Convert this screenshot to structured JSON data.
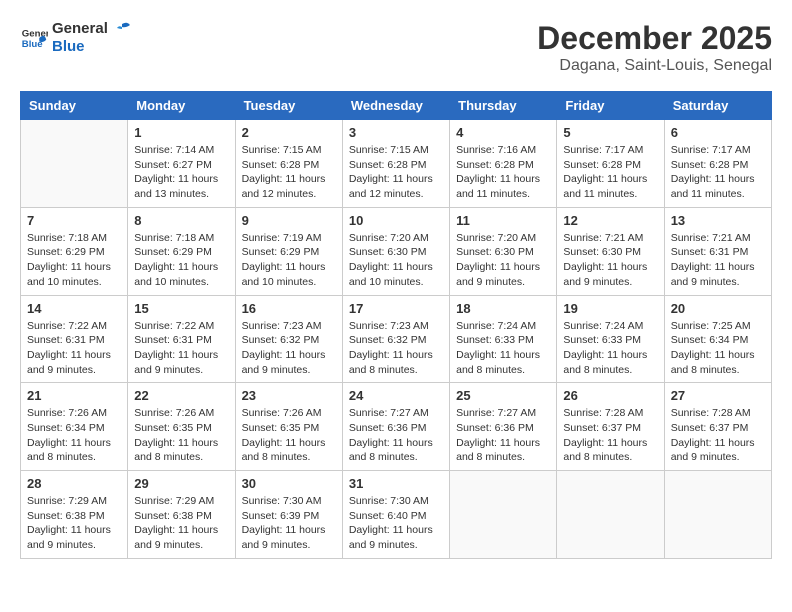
{
  "header": {
    "logo_general": "General",
    "logo_blue": "Blue",
    "month": "December 2025",
    "location": "Dagana, Saint-Louis, Senegal"
  },
  "days_of_week": [
    "Sunday",
    "Monday",
    "Tuesday",
    "Wednesday",
    "Thursday",
    "Friday",
    "Saturday"
  ],
  "weeks": [
    [
      {
        "day": "",
        "info": ""
      },
      {
        "day": "1",
        "info": "Sunrise: 7:14 AM\nSunset: 6:27 PM\nDaylight: 11 hours\nand 13 minutes."
      },
      {
        "day": "2",
        "info": "Sunrise: 7:15 AM\nSunset: 6:28 PM\nDaylight: 11 hours\nand 12 minutes."
      },
      {
        "day": "3",
        "info": "Sunrise: 7:15 AM\nSunset: 6:28 PM\nDaylight: 11 hours\nand 12 minutes."
      },
      {
        "day": "4",
        "info": "Sunrise: 7:16 AM\nSunset: 6:28 PM\nDaylight: 11 hours\nand 11 minutes."
      },
      {
        "day": "5",
        "info": "Sunrise: 7:17 AM\nSunset: 6:28 PM\nDaylight: 11 hours\nand 11 minutes."
      },
      {
        "day": "6",
        "info": "Sunrise: 7:17 AM\nSunset: 6:28 PM\nDaylight: 11 hours\nand 11 minutes."
      }
    ],
    [
      {
        "day": "7",
        "info": "Sunrise: 7:18 AM\nSunset: 6:29 PM\nDaylight: 11 hours\nand 10 minutes."
      },
      {
        "day": "8",
        "info": "Sunrise: 7:18 AM\nSunset: 6:29 PM\nDaylight: 11 hours\nand 10 minutes."
      },
      {
        "day": "9",
        "info": "Sunrise: 7:19 AM\nSunset: 6:29 PM\nDaylight: 11 hours\nand 10 minutes."
      },
      {
        "day": "10",
        "info": "Sunrise: 7:20 AM\nSunset: 6:30 PM\nDaylight: 11 hours\nand 10 minutes."
      },
      {
        "day": "11",
        "info": "Sunrise: 7:20 AM\nSunset: 6:30 PM\nDaylight: 11 hours\nand 9 minutes."
      },
      {
        "day": "12",
        "info": "Sunrise: 7:21 AM\nSunset: 6:30 PM\nDaylight: 11 hours\nand 9 minutes."
      },
      {
        "day": "13",
        "info": "Sunrise: 7:21 AM\nSunset: 6:31 PM\nDaylight: 11 hours\nand 9 minutes."
      }
    ],
    [
      {
        "day": "14",
        "info": "Sunrise: 7:22 AM\nSunset: 6:31 PM\nDaylight: 11 hours\nand 9 minutes."
      },
      {
        "day": "15",
        "info": "Sunrise: 7:22 AM\nSunset: 6:31 PM\nDaylight: 11 hours\nand 9 minutes."
      },
      {
        "day": "16",
        "info": "Sunrise: 7:23 AM\nSunset: 6:32 PM\nDaylight: 11 hours\nand 9 minutes."
      },
      {
        "day": "17",
        "info": "Sunrise: 7:23 AM\nSunset: 6:32 PM\nDaylight: 11 hours\nand 8 minutes."
      },
      {
        "day": "18",
        "info": "Sunrise: 7:24 AM\nSunset: 6:33 PM\nDaylight: 11 hours\nand 8 minutes."
      },
      {
        "day": "19",
        "info": "Sunrise: 7:24 AM\nSunset: 6:33 PM\nDaylight: 11 hours\nand 8 minutes."
      },
      {
        "day": "20",
        "info": "Sunrise: 7:25 AM\nSunset: 6:34 PM\nDaylight: 11 hours\nand 8 minutes."
      }
    ],
    [
      {
        "day": "21",
        "info": "Sunrise: 7:26 AM\nSunset: 6:34 PM\nDaylight: 11 hours\nand 8 minutes."
      },
      {
        "day": "22",
        "info": "Sunrise: 7:26 AM\nSunset: 6:35 PM\nDaylight: 11 hours\nand 8 minutes."
      },
      {
        "day": "23",
        "info": "Sunrise: 7:26 AM\nSunset: 6:35 PM\nDaylight: 11 hours\nand 8 minutes."
      },
      {
        "day": "24",
        "info": "Sunrise: 7:27 AM\nSunset: 6:36 PM\nDaylight: 11 hours\nand 8 minutes."
      },
      {
        "day": "25",
        "info": "Sunrise: 7:27 AM\nSunset: 6:36 PM\nDaylight: 11 hours\nand 8 minutes."
      },
      {
        "day": "26",
        "info": "Sunrise: 7:28 AM\nSunset: 6:37 PM\nDaylight: 11 hours\nand 8 minutes."
      },
      {
        "day": "27",
        "info": "Sunrise: 7:28 AM\nSunset: 6:37 PM\nDaylight: 11 hours\nand 9 minutes."
      }
    ],
    [
      {
        "day": "28",
        "info": "Sunrise: 7:29 AM\nSunset: 6:38 PM\nDaylight: 11 hours\nand 9 minutes."
      },
      {
        "day": "29",
        "info": "Sunrise: 7:29 AM\nSunset: 6:38 PM\nDaylight: 11 hours\nand 9 minutes."
      },
      {
        "day": "30",
        "info": "Sunrise: 7:30 AM\nSunset: 6:39 PM\nDaylight: 11 hours\nand 9 minutes."
      },
      {
        "day": "31",
        "info": "Sunrise: 7:30 AM\nSunset: 6:40 PM\nDaylight: 11 hours\nand 9 minutes."
      },
      {
        "day": "",
        "info": ""
      },
      {
        "day": "",
        "info": ""
      },
      {
        "day": "",
        "info": ""
      }
    ]
  ]
}
